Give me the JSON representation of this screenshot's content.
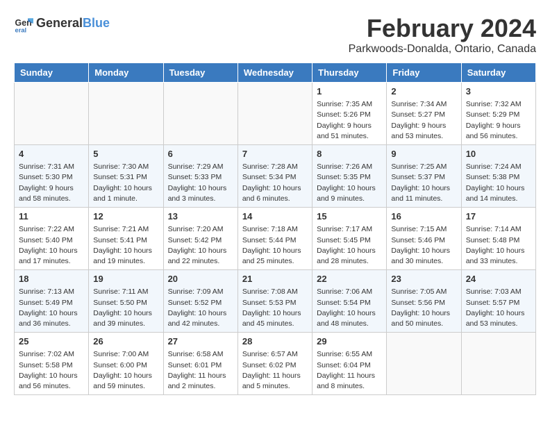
{
  "logo": {
    "text_general": "General",
    "text_blue": "Blue"
  },
  "title": "February 2024",
  "subtitle": "Parkwoods-Donalda, Ontario, Canada",
  "headers": [
    "Sunday",
    "Monday",
    "Tuesday",
    "Wednesday",
    "Thursday",
    "Friday",
    "Saturday"
  ],
  "weeks": [
    [
      {
        "day": "",
        "info": ""
      },
      {
        "day": "",
        "info": ""
      },
      {
        "day": "",
        "info": ""
      },
      {
        "day": "",
        "info": ""
      },
      {
        "day": "1",
        "info": "Sunrise: 7:35 AM\nSunset: 5:26 PM\nDaylight: 9 hours\nand 51 minutes."
      },
      {
        "day": "2",
        "info": "Sunrise: 7:34 AM\nSunset: 5:27 PM\nDaylight: 9 hours\nand 53 minutes."
      },
      {
        "day": "3",
        "info": "Sunrise: 7:32 AM\nSunset: 5:29 PM\nDaylight: 9 hours\nand 56 minutes."
      }
    ],
    [
      {
        "day": "4",
        "info": "Sunrise: 7:31 AM\nSunset: 5:30 PM\nDaylight: 9 hours\nand 58 minutes."
      },
      {
        "day": "5",
        "info": "Sunrise: 7:30 AM\nSunset: 5:31 PM\nDaylight: 10 hours\nand 1 minute."
      },
      {
        "day": "6",
        "info": "Sunrise: 7:29 AM\nSunset: 5:33 PM\nDaylight: 10 hours\nand 3 minutes."
      },
      {
        "day": "7",
        "info": "Sunrise: 7:28 AM\nSunset: 5:34 PM\nDaylight: 10 hours\nand 6 minutes."
      },
      {
        "day": "8",
        "info": "Sunrise: 7:26 AM\nSunset: 5:35 PM\nDaylight: 10 hours\nand 9 minutes."
      },
      {
        "day": "9",
        "info": "Sunrise: 7:25 AM\nSunset: 5:37 PM\nDaylight: 10 hours\nand 11 minutes."
      },
      {
        "day": "10",
        "info": "Sunrise: 7:24 AM\nSunset: 5:38 PM\nDaylight: 10 hours\nand 14 minutes."
      }
    ],
    [
      {
        "day": "11",
        "info": "Sunrise: 7:22 AM\nSunset: 5:40 PM\nDaylight: 10 hours\nand 17 minutes."
      },
      {
        "day": "12",
        "info": "Sunrise: 7:21 AM\nSunset: 5:41 PM\nDaylight: 10 hours\nand 19 minutes."
      },
      {
        "day": "13",
        "info": "Sunrise: 7:20 AM\nSunset: 5:42 PM\nDaylight: 10 hours\nand 22 minutes."
      },
      {
        "day": "14",
        "info": "Sunrise: 7:18 AM\nSunset: 5:44 PM\nDaylight: 10 hours\nand 25 minutes."
      },
      {
        "day": "15",
        "info": "Sunrise: 7:17 AM\nSunset: 5:45 PM\nDaylight: 10 hours\nand 28 minutes."
      },
      {
        "day": "16",
        "info": "Sunrise: 7:15 AM\nSunset: 5:46 PM\nDaylight: 10 hours\nand 30 minutes."
      },
      {
        "day": "17",
        "info": "Sunrise: 7:14 AM\nSunset: 5:48 PM\nDaylight: 10 hours\nand 33 minutes."
      }
    ],
    [
      {
        "day": "18",
        "info": "Sunrise: 7:13 AM\nSunset: 5:49 PM\nDaylight: 10 hours\nand 36 minutes."
      },
      {
        "day": "19",
        "info": "Sunrise: 7:11 AM\nSunset: 5:50 PM\nDaylight: 10 hours\nand 39 minutes."
      },
      {
        "day": "20",
        "info": "Sunrise: 7:09 AM\nSunset: 5:52 PM\nDaylight: 10 hours\nand 42 minutes."
      },
      {
        "day": "21",
        "info": "Sunrise: 7:08 AM\nSunset: 5:53 PM\nDaylight: 10 hours\nand 45 minutes."
      },
      {
        "day": "22",
        "info": "Sunrise: 7:06 AM\nSunset: 5:54 PM\nDaylight: 10 hours\nand 48 minutes."
      },
      {
        "day": "23",
        "info": "Sunrise: 7:05 AM\nSunset: 5:56 PM\nDaylight: 10 hours\nand 50 minutes."
      },
      {
        "day": "24",
        "info": "Sunrise: 7:03 AM\nSunset: 5:57 PM\nDaylight: 10 hours\nand 53 minutes."
      }
    ],
    [
      {
        "day": "25",
        "info": "Sunrise: 7:02 AM\nSunset: 5:58 PM\nDaylight: 10 hours\nand 56 minutes."
      },
      {
        "day": "26",
        "info": "Sunrise: 7:00 AM\nSunset: 6:00 PM\nDaylight: 10 hours\nand 59 minutes."
      },
      {
        "day": "27",
        "info": "Sunrise: 6:58 AM\nSunset: 6:01 PM\nDaylight: 11 hours\nand 2 minutes."
      },
      {
        "day": "28",
        "info": "Sunrise: 6:57 AM\nSunset: 6:02 PM\nDaylight: 11 hours\nand 5 minutes."
      },
      {
        "day": "29",
        "info": "Sunrise: 6:55 AM\nSunset: 6:04 PM\nDaylight: 11 hours\nand 8 minutes."
      },
      {
        "day": "",
        "info": ""
      },
      {
        "day": "",
        "info": ""
      }
    ]
  ]
}
